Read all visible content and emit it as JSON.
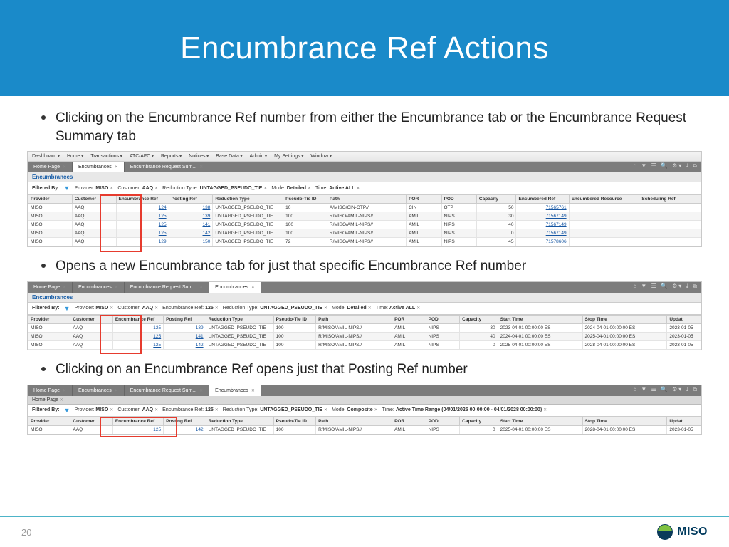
{
  "title": "Encumbrance Ref Actions",
  "bullets": [
    "Clicking on the Encumbrance Ref number from either the Encumbrance tab or the Encumbrance Request Summary tab",
    "Opens a new Encumbrance tab for just that specific Encumbrance Ref number",
    "Clicking on an Encumbrance Ref opens just that Posting Ref number"
  ],
  "ribbon": [
    "Dashboard",
    "Home",
    "Transactions",
    "ATC/AFC",
    "Reports",
    "Notices",
    "Base Data",
    "Admin",
    "My Settings",
    "Window"
  ],
  "section_label": "Encumbrances",
  "filter_label": "Filtered By:",
  "toolbar_icons": "⌂  ▼  ☰  🔍  ⚙▾  ⤓  ⧉",
  "shot1": {
    "tabs": [
      {
        "label": "Home Page",
        "active": false,
        "close": true
      },
      {
        "label": "Encumbrances",
        "active": true,
        "close": true
      },
      {
        "label": "Encumbrance Request Sum...",
        "active": false,
        "close": true
      }
    ],
    "chips": [
      {
        "k": "Provider",
        "v": "MISO"
      },
      {
        "k": "Customer",
        "v": "AAQ"
      },
      {
        "k": "Reduction Type",
        "v": "UNTAGGED_PSEUDO_TIE"
      },
      {
        "k": "Mode",
        "v": "Detailed"
      },
      {
        "k": "Time",
        "v": "Active ALL"
      }
    ],
    "headers": [
      "Provider",
      "Customer",
      "Encumbrance Ref",
      "Posting Ref",
      "Reduction Type",
      "Pseudo-Tie ID",
      "Path",
      "POR",
      "POD",
      "Capacity",
      "Encumbered Ref",
      "Encumbered Resource",
      "Scheduling Ref"
    ],
    "widths": [
      50,
      50,
      60,
      50,
      80,
      50,
      90,
      40,
      40,
      45,
      60,
      80,
      70
    ],
    "rows": [
      [
        "MISO",
        "AAQ",
        "124",
        "138",
        "UNTAGGED_PSEUDO_TIE",
        "10",
        "A/MISO/CIN-OTP//",
        "CIN",
        "OTP",
        "50",
        "71565761",
        "",
        ""
      ],
      [
        "MISO",
        "AAQ",
        "125",
        "139",
        "UNTAGGED_PSEUDO_TIE",
        "100",
        "R/MISO/AMIL-NIPS//",
        "AMIL",
        "NIPS",
        "30",
        "71567149",
        "",
        ""
      ],
      [
        "MISO",
        "AAQ",
        "125",
        "141",
        "UNTAGGED_PSEUDO_TIE",
        "100",
        "R/MISO/AMIL-NIPS//",
        "AMIL",
        "NIPS",
        "40",
        "71567149",
        "",
        ""
      ],
      [
        "MISO",
        "AAQ",
        "125",
        "142",
        "UNTAGGED_PSEUDO_TIE",
        "100",
        "R/MISO/AMIL-NIPS//",
        "AMIL",
        "NIPS",
        "0",
        "71567149",
        "",
        ""
      ],
      [
        "MISO",
        "AAQ",
        "129",
        "150",
        "UNTAGGED_PSEUDO_TIE",
        "72",
        "R/MISO/AMIL-NIPS//",
        "AMIL",
        "NIPS",
        "45",
        "71578606",
        "",
        ""
      ]
    ],
    "link_cols": [
      2,
      3,
      10
    ],
    "num_cols": [
      9
    ],
    "redbox": {
      "col": 2
    }
  },
  "shot2": {
    "tabs": [
      {
        "label": "Home Page",
        "active": false,
        "close": true
      },
      {
        "label": "Encumbrances",
        "active": false,
        "close": true
      },
      {
        "label": "Encumbrance Request Sum...",
        "active": false,
        "close": true
      },
      {
        "label": "Encumbrances",
        "active": true,
        "close": true
      }
    ],
    "chips": [
      {
        "k": "Provider",
        "v": "MISO"
      },
      {
        "k": "Customer",
        "v": "AAQ"
      },
      {
        "k": "Encumbrance Ref",
        "v": "125"
      },
      {
        "k": "Reduction Type",
        "v": "UNTAGGED_PSEUDO_TIE"
      },
      {
        "k": "Mode",
        "v": "Detailed"
      },
      {
        "k": "Time",
        "v": "Active ALL"
      }
    ],
    "headers": [
      "Provider",
      "Customer",
      "Encumbrance Ref",
      "Posting Ref",
      "Reduction Type",
      "Pseudo-Tie ID",
      "Path",
      "POR",
      "POD",
      "Capacity",
      "Start Time",
      "Stop Time",
      "Updat"
    ],
    "widths": [
      50,
      50,
      60,
      50,
      80,
      50,
      90,
      40,
      40,
      45,
      100,
      100,
      40
    ],
    "rows": [
      [
        "MISO",
        "AAQ",
        "125",
        "139",
        "UNTAGGED_PSEUDO_TIE",
        "100",
        "R/MISO/AMIL-NIPS//",
        "AMIL",
        "NIPS",
        "30",
        "2023-04-01 00:00:00 ES",
        "2024-04-01 00:00:00 ES",
        "2023-01-05"
      ],
      [
        "MISO",
        "AAQ",
        "125",
        "141",
        "UNTAGGED_PSEUDO_TIE",
        "100",
        "R/MISO/AMIL-NIPS//",
        "AMIL",
        "NIPS",
        "40",
        "2024-04-01 00:00:00 ES",
        "2025-04-01 00:00:00 ES",
        "2023-01-05"
      ],
      [
        "MISO",
        "AAQ",
        "125",
        "142",
        "UNTAGGED_PSEUDO_TIE",
        "100",
        "R/MISO/AMIL-NIPS//",
        "AMIL",
        "NIPS",
        "0",
        "2025-04-01 00:00:00 ES",
        "2028-04-01 00:00:00 ES",
        "2023-01-05"
      ]
    ],
    "link_cols": [
      2,
      3
    ],
    "num_cols": [
      9
    ],
    "redbox": {
      "col": 2
    }
  },
  "shot3": {
    "tabs": [
      {
        "label": "Home Page",
        "active": false,
        "close": true
      },
      {
        "label": "Encumbrances",
        "active": false,
        "close": true
      },
      {
        "label": "Encumbrance Request Sum...",
        "active": false,
        "close": true
      },
      {
        "label": "Encumbrances",
        "active": true,
        "close": true
      }
    ],
    "subtab": "Home Page",
    "chips": [
      {
        "k": "Provider",
        "v": "MISO"
      },
      {
        "k": "Customer",
        "v": "AAQ"
      },
      {
        "k": "Encumbrance Ref",
        "v": "125"
      },
      {
        "k": "Reduction Type",
        "v": "UNTAGGED_PSEUDO_TIE"
      },
      {
        "k": "Mode",
        "v": "Composite"
      },
      {
        "k": "Time",
        "v": "Active Time Range (04/01/2025 00:00:00 - 04/01/2028 00:00:00)"
      }
    ],
    "headers": [
      "Provider",
      "Customer",
      "Encumbrance Ref",
      "Posting Ref",
      "Reduction Type",
      "Pseudo-Tie ID",
      "Path",
      "POR",
      "POD",
      "Capacity",
      "Start Time",
      "Stop Time",
      "Updat"
    ],
    "widths": [
      50,
      50,
      60,
      50,
      80,
      50,
      90,
      40,
      40,
      45,
      100,
      100,
      40
    ],
    "rows": [
      [
        "MISO",
        "AAQ",
        "125",
        "142",
        "UNTAGGED_PSEUDO_TIE",
        "100",
        "R/MISO/AMIL-NIPS//",
        "AMIL",
        "NIPS",
        "0",
        "2025-04-01 00:00:00 ES",
        "2028-04-01 00:00:00 ES",
        "2023-01-05"
      ]
    ],
    "link_cols": [
      2,
      3
    ],
    "num_cols": [
      9
    ],
    "redbox": {
      "col": 2,
      "span": 2
    }
  },
  "page_number": "20",
  "logo_text": "MISO"
}
